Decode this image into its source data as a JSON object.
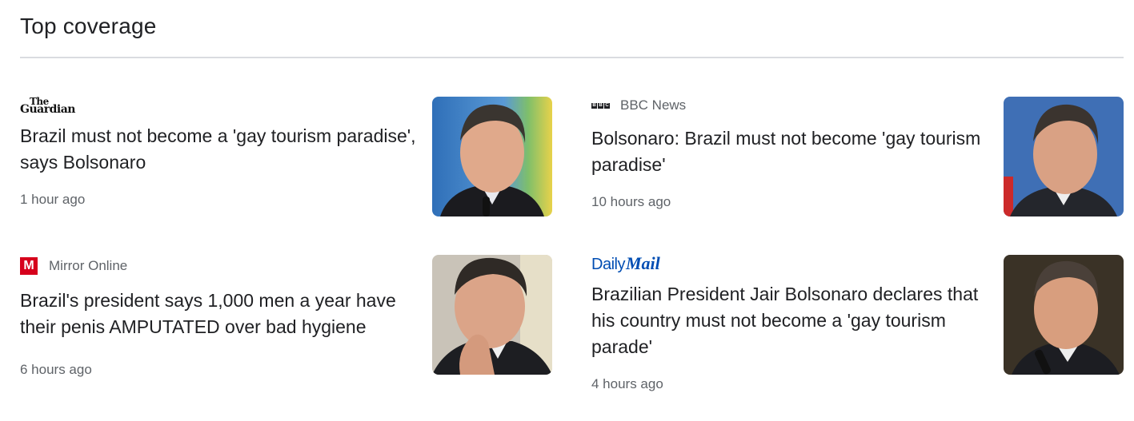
{
  "section": {
    "title": "Top coverage"
  },
  "articles": [
    {
      "source_logo_line1": "The",
      "source_logo_line2": "Guardian",
      "source_name": "",
      "headline": "Brazil must not become a 'gay tourism paradise', says Bolsonaro",
      "time": "1 hour ago"
    },
    {
      "source_logo": "BBC",
      "source_name": "BBC News",
      "headline": "Bolsonaro: Brazil must not become 'gay tourism paradise'",
      "time": "10 hours ago"
    },
    {
      "source_logo": "M",
      "source_name": "Mirror Online",
      "headline": "Brazil's president says 1,000 men a year have their penis AMPUTATED over bad hygiene",
      "time": "6 hours ago"
    },
    {
      "source_logo_part1": "Daily",
      "source_logo_part2": "Mail",
      "source_name": "",
      "headline": "Brazilian President Jair Bolsonaro declares that his country must not become a 'gay tourism parade'",
      "time": "4 hours ago"
    }
  ],
  "colors": {
    "text_primary": "#202124",
    "text_secondary": "#5f6368",
    "divider": "#dadce0",
    "mirror_red": "#d6001c",
    "dailymail_blue": "#004db3"
  }
}
